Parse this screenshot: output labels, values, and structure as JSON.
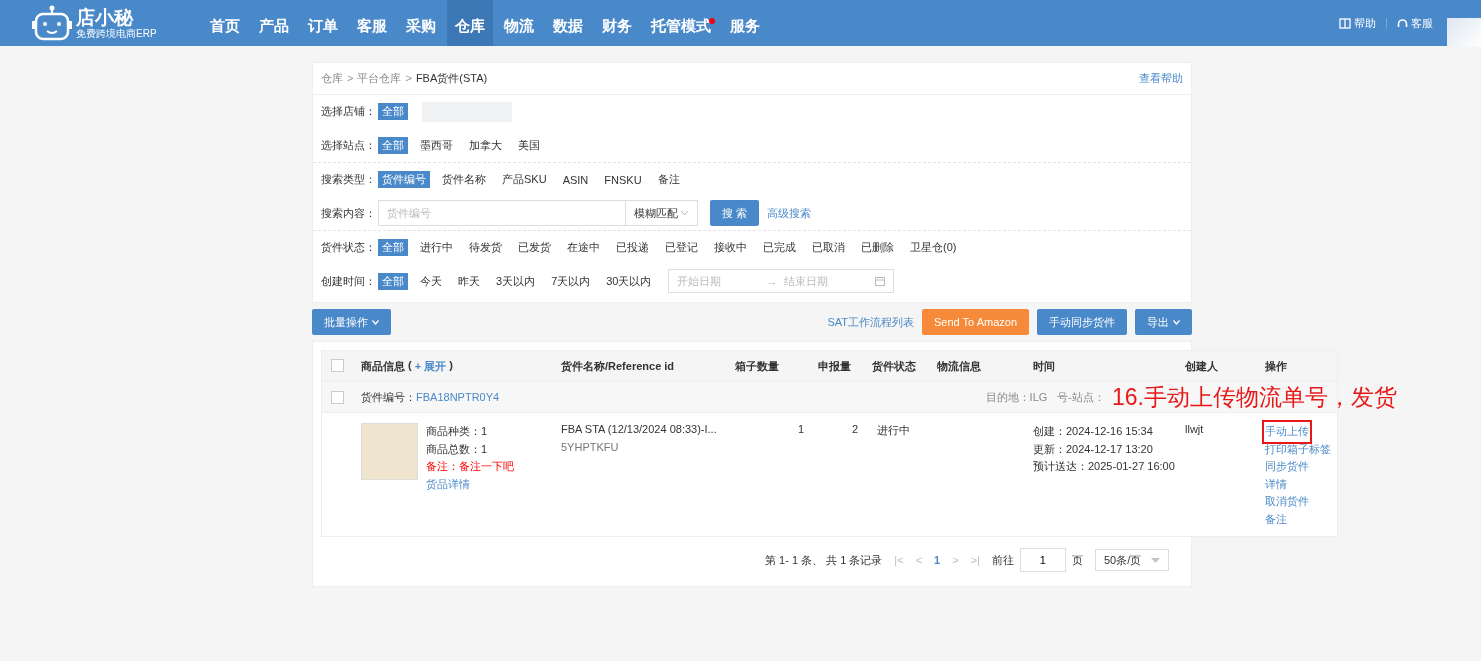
{
  "header": {
    "logo": {
      "name": "店小秘",
      "tagline": "免费跨境电商ERP"
    },
    "menu": [
      {
        "label": "首页",
        "selected": false,
        "badge": false
      },
      {
        "label": "产品",
        "selected": false,
        "badge": false
      },
      {
        "label": "订单",
        "selected": false,
        "badge": false
      },
      {
        "label": "客服",
        "selected": false,
        "badge": false
      },
      {
        "label": "采购",
        "selected": false,
        "badge": false
      },
      {
        "label": "仓库",
        "selected": true,
        "badge": false
      },
      {
        "label": "物流",
        "selected": false,
        "badge": false
      },
      {
        "label": "数据",
        "selected": false,
        "badge": false
      },
      {
        "label": "财务",
        "selected": false,
        "badge": false
      },
      {
        "label": "托管模式",
        "selected": false,
        "badge": true
      },
      {
        "label": "服务",
        "selected": false,
        "badge": false
      }
    ],
    "links": [
      {
        "kind": "help",
        "label": "帮助"
      },
      {
        "kind": "service",
        "label": "客服"
      }
    ]
  },
  "breadcrumb": {
    "items": [
      "仓库",
      "平台仓库",
      "FBA货件(STA)"
    ],
    "separator": ">",
    "help_link": "查看帮助"
  },
  "filters": [
    {
      "kind": "options",
      "label": "选择店铺：",
      "options": [
        {
          "label": "全部",
          "selected": true
        }
      ],
      "blurred": true,
      "divider": false
    },
    {
      "kind": "options",
      "label": "选择站点：",
      "options": [
        {
          "label": "全部",
          "selected": true
        },
        {
          "label": "墨西哥",
          "selected": false
        },
        {
          "label": "加拿大",
          "selected": false
        },
        {
          "label": "美国",
          "selected": false
        }
      ],
      "divider": true
    },
    {
      "kind": "options",
      "label": "搜索类型：",
      "options": [
        {
          "label": "货件编号",
          "selected": true
        },
        {
          "label": "货件名称",
          "selected": false
        },
        {
          "label": "产品SKU",
          "selected": false
        },
        {
          "label": "ASIN",
          "selected": false
        },
        {
          "label": "FNSKU",
          "selected": false
        },
        {
          "label": "备注",
          "selected": false
        }
      ],
      "divider": false
    },
    {
      "kind": "search",
      "label": "搜索内容：",
      "placeholder": "货件编号",
      "match": "模糊匹配",
      "button": "搜 索",
      "link": "高级搜索",
      "divider": true
    },
    {
      "kind": "options",
      "label": "货件状态：",
      "options": [
        {
          "label": "全部",
          "selected": true
        },
        {
          "label": "进行中",
          "selected": false
        },
        {
          "label": "待发货",
          "selected": false
        },
        {
          "label": "已发货",
          "selected": false
        },
        {
          "label": "在途中",
          "selected": false
        },
        {
          "label": "已投递",
          "selected": false
        },
        {
          "label": "已登记",
          "selected": false
        },
        {
          "label": "接收中",
          "selected": false
        },
        {
          "label": "已完成",
          "selected": false
        },
        {
          "label": "已取消",
          "selected": false
        },
        {
          "label": "已删除",
          "selected": false
        },
        {
          "label": "卫星仓(0)",
          "selected": false
        }
      ],
      "divider": false
    },
    {
      "kind": "dates",
      "label": "创建时间：",
      "options": [
        {
          "label": "全部",
          "selected": true
        },
        {
          "label": "今天",
          "selected": false
        },
        {
          "label": "昨天",
          "selected": false
        },
        {
          "label": "3天以内",
          "selected": false
        },
        {
          "label": "7天以内",
          "selected": false
        },
        {
          "label": "30天以内",
          "selected": false
        }
      ],
      "start_placeholder": "开始日期",
      "arrow": "→",
      "end_placeholder": "结束日期",
      "divider": false
    }
  ],
  "toolbar": {
    "batch": "批量操作",
    "link": "SAT工作流程列表",
    "buttons": [
      {
        "label": "Send To Amazon",
        "kind": "orange",
        "dropdown": false
      },
      {
        "label": "手动同步货件",
        "kind": "blue",
        "dropdown": false
      },
      {
        "label": "导出",
        "kind": "blue",
        "dropdown": true
      }
    ]
  },
  "table": {
    "select_all_checked": false,
    "columns": [
      {
        "label": "商品信息",
        "open": "(",
        "expand": "+ 展开",
        "close": ")"
      },
      {
        "label": "货件名称/Reference id"
      },
      {
        "label": "箱子数量"
      },
      {
        "label": "申报量"
      },
      {
        "label": "货件状态"
      },
      {
        "label": "物流信息"
      },
      {
        "label": "时间"
      },
      {
        "label": "创建人"
      },
      {
        "label": "操作"
      }
    ],
    "groups": [
      {
        "label": "货件编号：",
        "number": "FBA18NPTR0Y4",
        "destination": "目的地：ILG",
        "site": "号-站点：",
        "checked": false,
        "rows": [
          {
            "details": [
              {
                "kind": "text",
                "text": "商品种类：1"
              },
              {
                "kind": "text",
                "text": "商品总数：1"
              },
              {
                "kind": "note",
                "text": "备注：备注一下吧"
              },
              {
                "kind": "link",
                "text": "货品详情"
              }
            ],
            "name": "FBA STA (12/13/2024 08:33)-I...",
            "reference": "5YHPTKFU",
            "boxes": "1",
            "declared": "2",
            "status": "进行中",
            "times": [
              "创建：2024-12-16 15:34",
              "更新：2024-12-17 13:20",
              "预计送达：2025-01-27 16:00"
            ],
            "creator": "llwjt",
            "actions": [
              {
                "label": "手动上传",
                "highlighted": true
              },
              {
                "label": "打印箱子标签",
                "highlighted": false
              },
              {
                "label": "同步货件",
                "highlighted": false
              },
              {
                "label": "详情",
                "highlighted": false
              },
              {
                "label": "取消货件",
                "highlighted": false
              },
              {
                "label": "备注",
                "highlighted": false
              }
            ]
          }
        ]
      }
    ]
  },
  "pagination": {
    "summary": "第 1- 1 条、 共 1 条记录",
    "first": "|<",
    "prev": "<",
    "pages": [
      {
        "label": "1",
        "selected": true
      }
    ],
    "next": ">",
    "last": ">|",
    "goto": "前往",
    "page_value": "1",
    "page_unit": "页",
    "size": "50条/页"
  },
  "annotation": "16.手动上传物流单号，发货"
}
